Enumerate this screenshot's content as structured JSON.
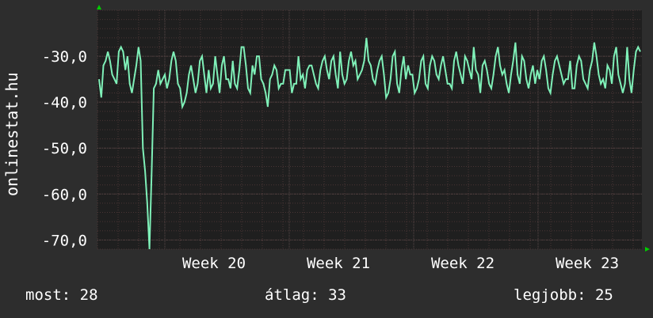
{
  "chart_data": {
    "type": "line",
    "ylabel": "onlinestat.hu",
    "y_ticks": [
      "-30,0",
      "-40,0",
      "-50,0",
      "-60,0",
      "-70,0"
    ],
    "y_tick_values": [
      -30,
      -40,
      -50,
      -60,
      -70
    ],
    "x_ticks": [
      "Week 20",
      "Week 21",
      "Week 22",
      "Week 23"
    ],
    "ylim": [
      -72,
      -20
    ],
    "grid": true,
    "series": [
      {
        "color": "#7ff0b8",
        "values": [
          -35,
          -39,
          -32,
          -31,
          -29,
          -31,
          -34,
          -35,
          -36,
          -29,
          -28,
          -29,
          -33,
          -30,
          -36,
          -38,
          -35,
          -32,
          -28,
          -31,
          -50,
          -55,
          -62,
          -72,
          -55,
          -37,
          -36,
          -33,
          -36,
          -35,
          -34,
          -37,
          -35,
          -31,
          -29,
          -31,
          -36,
          -37,
          -41,
          -40,
          -38,
          -34,
          -32,
          -35,
          -38,
          -36,
          -31,
          -30,
          -34,
          -38,
          -33,
          -37,
          -36,
          -30,
          -34,
          -38,
          -32,
          -30,
          -35,
          -35,
          -37,
          -31,
          -36,
          -37,
          -33,
          -28,
          -28,
          -32,
          -37,
          -38,
          -32,
          -34,
          -30,
          -30,
          -35,
          -36,
          -38,
          -41,
          -35,
          -34,
          -32,
          -33,
          -37,
          -36,
          -36,
          -33,
          -33,
          -33,
          -38,
          -36,
          -36,
          -30,
          -35,
          -34,
          -37,
          -33,
          -32,
          -32,
          -34,
          -36,
          -37,
          -33,
          -31,
          -30,
          -33,
          -35,
          -31,
          -30,
          -34,
          -37,
          -29,
          -34,
          -36,
          -35,
          -31,
          -29,
          -32,
          -31,
          -35,
          -34,
          -33,
          -31,
          -26,
          -31,
          -32,
          -35,
          -36,
          -33,
          -31,
          -30,
          -34,
          -39,
          -38,
          -35,
          -30,
          -29,
          -36,
          -38,
          -33,
          -30,
          -35,
          -32,
          -34,
          -34,
          -38,
          -37,
          -35,
          -31,
          -30,
          -36,
          -37,
          -32,
          -30,
          -31,
          -34,
          -35,
          -32,
          -30,
          -33,
          -36,
          -36,
          -37,
          -31,
          -29,
          -32,
          -34,
          -36,
          -30,
          -31,
          -33,
          -35,
          -28,
          -33,
          -34,
          -38,
          -32,
          -31,
          -33,
          -36,
          -37,
          -34,
          -30,
          -28,
          -32,
          -34,
          -33,
          -36,
          -38,
          -34,
          -31,
          -27,
          -34,
          -36,
          -30,
          -31,
          -35,
          -37,
          -34,
          -32,
          -36,
          -33,
          -35,
          -31,
          -30,
          -33,
          -37,
          -38,
          -34,
          -31,
          -30,
          -32,
          -34,
          -36,
          -35,
          -35,
          -31,
          -37,
          -37,
          -32,
          -30,
          -31,
          -35,
          -36,
          -37,
          -33,
          -31,
          -27,
          -30,
          -34,
          -36,
          -35,
          -37,
          -32,
          -33,
          -36,
          -30,
          -28,
          -34,
          -36,
          -38,
          -36,
          -28,
          -35,
          -38,
          -33,
          -29,
          -28,
          -29
        ]
      }
    ]
  },
  "stats": {
    "most": "most: 28",
    "atlag": "átlag: 33",
    "legjobb": "legjobb: 25"
  },
  "colors": {
    "background": "#2d2d2d",
    "plot_background": "#1f1f1f",
    "line": "#7ff0b8",
    "axis_arrow": "#00cc00",
    "grid_minor": "#4a3535",
    "grid_major": "#5a4848"
  }
}
